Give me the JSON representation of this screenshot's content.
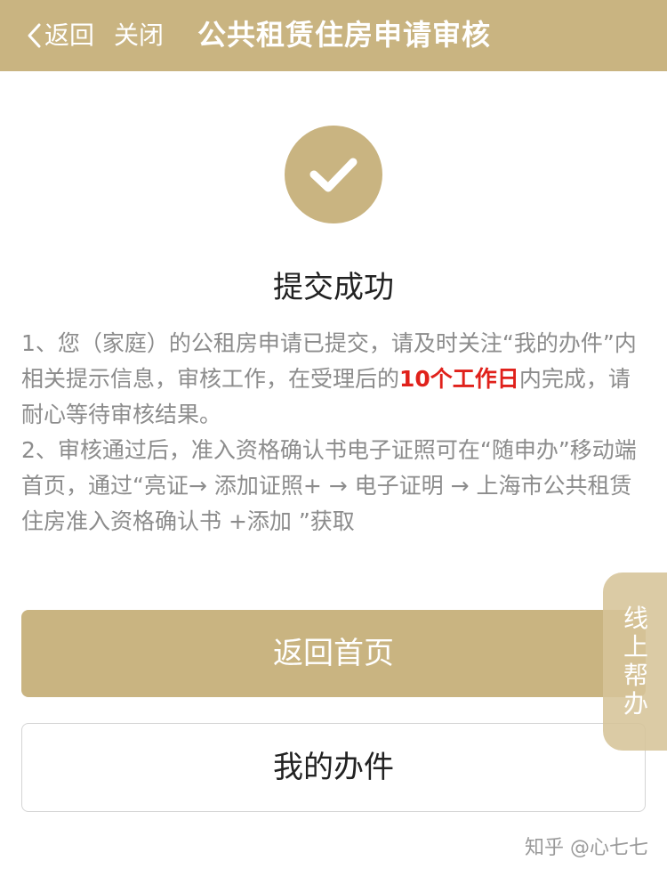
{
  "header": {
    "back_label": "返回",
    "close_label": "关闭",
    "title": "公共租赁住房申请审核"
  },
  "result": {
    "icon": "checkmark-icon",
    "title": "提交成功"
  },
  "notice": {
    "line1_before": "1、您（家庭）的公租房申请已提交，请及时关注“我的办件”内相关提示信息，审核工作，在受理后的",
    "line1_highlight": "10个工作日",
    "line1_after": "内完成，请耐心等待审核结果。",
    "line2": "2、审核通过后，准入资格确认书电子证照可在“随申办”移动端首页，通过“亮证→ 添加证照+ → 电子证明 → 上海市公共租赁住房准入资格确认书 +添加 ”获取"
  },
  "buttons": {
    "home": "返回首页",
    "my_items": "我的办件"
  },
  "side_tab": {
    "label": "线上帮办"
  },
  "watermark": "知乎 @心七七",
  "colors": {
    "brand_gold": "#c9b481",
    "highlight_red": "#e0211b",
    "body_text_gray": "#8c8c8c"
  }
}
